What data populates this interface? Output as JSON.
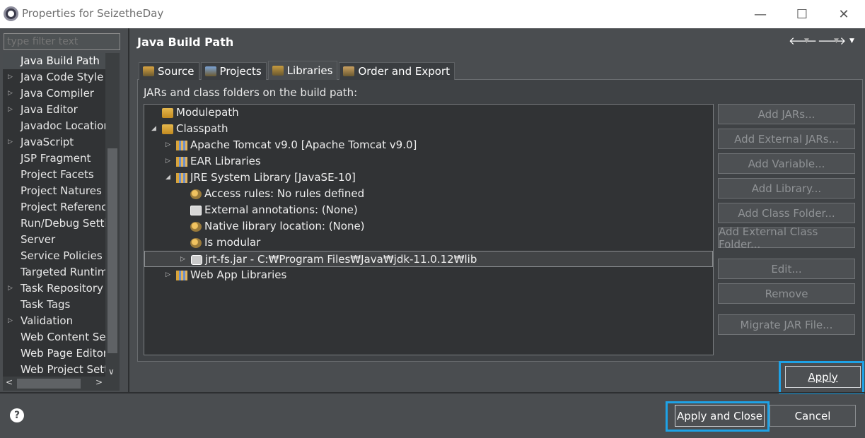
{
  "window": {
    "title": "Properties for SeizetheDay",
    "minimize_glyph": "—",
    "maximize_glyph": "☐",
    "close_glyph": "✕"
  },
  "sidebar": {
    "filter_placeholder": "type filter text",
    "items": [
      {
        "label": "Java Build Path",
        "expandable": false,
        "selected": true
      },
      {
        "label": "Java Code Style",
        "expandable": true
      },
      {
        "label": "Java Compiler",
        "expandable": true
      },
      {
        "label": "Java Editor",
        "expandable": true
      },
      {
        "label": "Javadoc Location",
        "expandable": false
      },
      {
        "label": "JavaScript",
        "expandable": true
      },
      {
        "label": "JSP Fragment",
        "expandable": false
      },
      {
        "label": "Project Facets",
        "expandable": false
      },
      {
        "label": "Project Natures",
        "expandable": false
      },
      {
        "label": "Project References",
        "expandable": false
      },
      {
        "label": "Run/Debug Settings",
        "expandable": false
      },
      {
        "label": "Server",
        "expandable": false
      },
      {
        "label": "Service Policies",
        "expandable": false
      },
      {
        "label": "Targeted Runtimes",
        "expandable": false
      },
      {
        "label": "Task Repository",
        "expandable": true
      },
      {
        "label": "Task Tags",
        "expandable": false
      },
      {
        "label": "Validation",
        "expandable": true
      },
      {
        "label": "Web Content Settings",
        "expandable": false
      },
      {
        "label": "Web Page Editor",
        "expandable": false
      },
      {
        "label": "Web Project Settings",
        "expandable": false
      }
    ]
  },
  "page": {
    "title": "Java Build Path",
    "tabs": [
      {
        "label": "Source",
        "icon": "source-folder-icon"
      },
      {
        "label": "Projects",
        "icon": "projects-icon"
      },
      {
        "label": "Libraries",
        "icon": "libraries-icon",
        "active": true
      },
      {
        "label": "Order and Export",
        "icon": "order-export-icon"
      }
    ],
    "description": "JARs and class folders on the build path:"
  },
  "tree": [
    {
      "label": "Modulepath",
      "indent": 0,
      "expander": "",
      "icon": "modulepath-icon"
    },
    {
      "label": "Classpath",
      "indent": 0,
      "expander": "◢",
      "icon": "classpath-icon"
    },
    {
      "label": "Apache Tomcat v9.0 [Apache Tomcat v9.0]",
      "indent": 1,
      "expander": "▷",
      "icon": "library-icon"
    },
    {
      "label": "EAR Libraries",
      "indent": 1,
      "expander": "▷",
      "icon": "library-icon"
    },
    {
      "label": "JRE System Library [JavaSE-10]",
      "indent": 1,
      "expander": "◢",
      "icon": "library-icon"
    },
    {
      "label": "Access rules: No rules defined",
      "indent": 2,
      "expander": "",
      "icon": "access-rules-icon"
    },
    {
      "label": "External annotations: (None)",
      "indent": 2,
      "expander": "",
      "icon": "annotations-icon"
    },
    {
      "label": "Native library location: (None)",
      "indent": 2,
      "expander": "",
      "icon": "native-library-icon"
    },
    {
      "label": "Is modular",
      "indent": 2,
      "expander": "",
      "icon": "modular-icon"
    },
    {
      "label": "jrt-fs.jar - C:₩Program Files₩Java₩jdk-11.0.12₩lib",
      "indent": 2,
      "expander": "▷",
      "icon": "jar-icon",
      "selected": true
    },
    {
      "label": "Web App Libraries",
      "indent": 1,
      "expander": "▷",
      "icon": "library-icon"
    }
  ],
  "side_buttons": [
    {
      "label": "Add JARs...",
      "name": "add-jars-button"
    },
    {
      "label": "Add External JARs...",
      "name": "add-external-jars-button"
    },
    {
      "label": "Add Variable...",
      "name": "add-variable-button"
    },
    {
      "label": "Add Library...",
      "name": "add-library-button"
    },
    {
      "label": "Add Class Folder...",
      "name": "add-class-folder-button"
    },
    {
      "label": "Add External Class Folder...",
      "name": "add-external-class-folder-button"
    },
    {
      "label": "Edit...",
      "name": "edit-button"
    },
    {
      "label": "Remove",
      "name": "remove-button"
    },
    {
      "label": "Migrate JAR File...",
      "name": "migrate-jar-button"
    }
  ],
  "footer": {
    "apply_label": "Apply",
    "apply_close_label": "Apply and Close",
    "cancel_label": "Cancel",
    "help_glyph": "?"
  },
  "colors": {
    "background": "#4a4d50",
    "highlight": "#1ea2e6",
    "tree_background": "#313335"
  }
}
